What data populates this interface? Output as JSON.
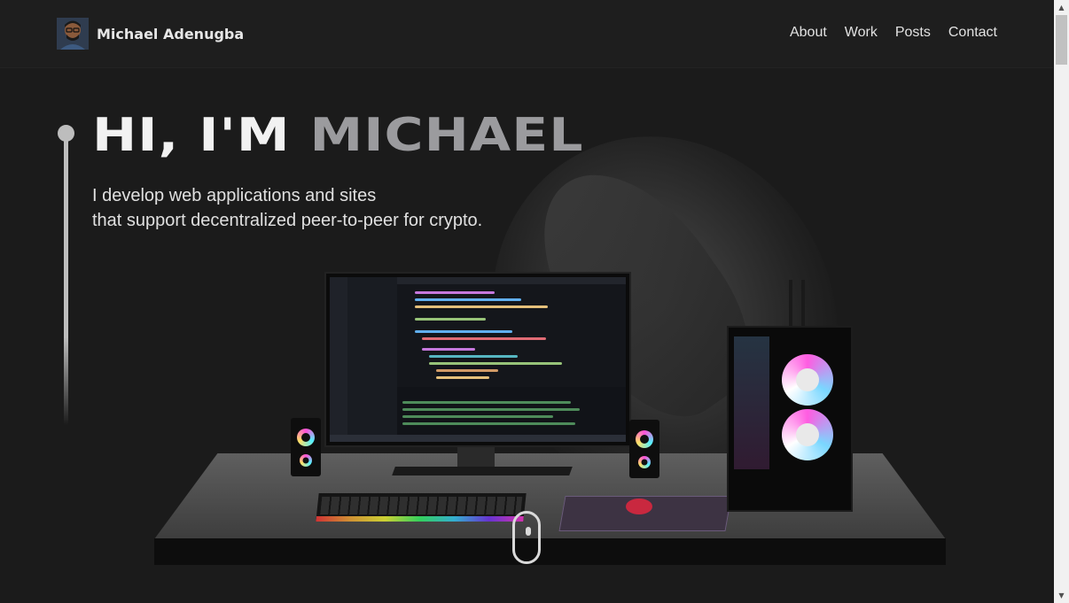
{
  "navbar": {
    "brand_name": "Michael Adenugba",
    "links": [
      "About",
      "Work",
      "Posts",
      "Contact"
    ]
  },
  "hero": {
    "title_part1": "HI, I'M ",
    "title_part2": "MICHAEL",
    "subtitle_line1": "I develop web applications and sites",
    "subtitle_line2": "that support decentralized peer-to-peer for crypto."
  },
  "colors": {
    "background": "#1b1b1b",
    "navbar": "#1e1e1e",
    "title_primary": "#f2f2f2",
    "title_accent": "#9b9b9e"
  },
  "icons": {
    "scroll": "mouse-scroll-icon",
    "scroll_up": "scroll-up-arrow-icon",
    "scroll_down": "scroll-down-arrow-icon"
  }
}
